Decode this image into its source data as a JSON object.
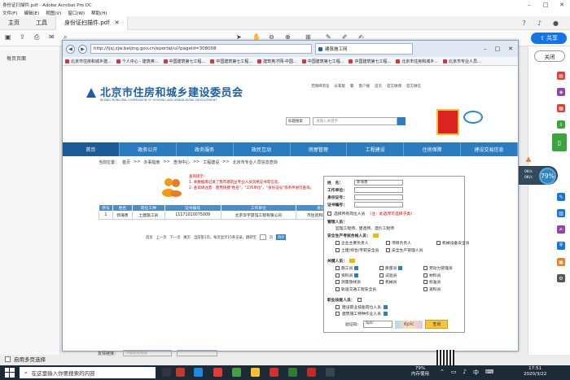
{
  "acrobat": {
    "window_title": "身份证扫描件.pdf - Adobe Acrobat Pro DC",
    "menu": [
      "文件(F)",
      "编辑(E)",
      "视图(V)",
      "窗口(W)",
      "帮助(H)"
    ],
    "tabs": {
      "home": "主页",
      "tools": "工具",
      "doc": "身份证扫描件.pdf"
    },
    "share": "共享",
    "left_panel_title": "每页页面",
    "multi_page_select": "启用多页选择",
    "close": "关闭"
  },
  "browser": {
    "url": "http://tjsj.zjw.beijing.gov.cn/eportal/ui?pageId=308008",
    "active_tab": "建筑施工网",
    "favorites": [
      "北京市住房和城乡建...",
      "个人中心 - 建筑英...",
      "中国建筑第七工程...",
      "中国建筑第七工程...",
      "建筑英才网-中国...",
      "中国建筑第七工程...",
      "中国建筑第七工程...",
      "北京市住房和城乡...",
      "北京市专业人员..."
    ]
  },
  "site": {
    "title": "北京市住房和城乡建设委员会",
    "subtitle": "BEIJING MUNICIPAL COMMISSION OF HOUSING AND URBAN-RURAL DEVELOPMENT",
    "top_links": [
      "无障碍浏览",
      "长辈版",
      "繁",
      "客户端",
      "首页",
      "官方微博",
      "官方微信"
    ],
    "search_select": "标题搜索",
    "search_placeholder": "请输入关键字",
    "nav": [
      "首页",
      "政务公开",
      "政务服务",
      "政民互动",
      "房屋管理",
      "工程建设",
      "住房保障",
      "建设交易信息"
    ],
    "breadcrumb": [
      "当前位置：",
      "首页",
      ">>",
      "办事指南",
      ">>",
      "查询中心",
      ">>",
      "工程建设",
      ">>",
      "北京市专业人员信息查询"
    ],
    "notice": {
      "title": "查询提示：",
      "line1": "1. 本数据库记录了我市建筑业专业人员资格证书等信息。",
      "line2": "2. 查询请注意：使用快捷\"姓名\"，\"工作单位\"，\"身份证号\"等条件进行查询。"
    },
    "table": {
      "headers": [
        "序号",
        "姓名",
        "岗位工种",
        "证书编号",
        "工作单位",
        "发证机关"
      ],
      "rows": [
        [
          "1",
          "郭海勇",
          "土建施工员",
          "11171010075009",
          "北京华宇晟馆工程有限公司",
          "市住房和城乡建设委"
        ]
      ]
    },
    "pager": {
      "first": "首页",
      "prev": "上一页",
      "next": "下一页",
      "last": "尾页",
      "info": "当前第1页，每页显示15条记录，跳转至",
      "unit": "页",
      "go": "跳转"
    },
    "friend_links": "友情链接：",
    "friend_select": "市级政府网站"
  },
  "popup": {
    "name_label": "姓　名：",
    "name_value": "郭海勇",
    "work_unit_label": "工作单位：",
    "id_label": "身份证号：",
    "cert_label": "证书编号：",
    "select_all": "选择所有岗位人员",
    "select_hint": "（注：此选项可选择子类）",
    "sec1_title": "管理人员：",
    "sec1_items": "监理工程师、建造师、造价工程师",
    "sec2_title": "安全生产考核合格人员：",
    "sec2_items": [
      "企业主要负责人",
      "项目负责人",
      "机械设备安全员",
      "土建/综合/专职安全员",
      "安全生产管理人员"
    ],
    "sec3_title": "关键人员：",
    "sec3_items": [
      "施工员",
      "质量员",
      "劳动力管理员",
      "资料员",
      "试验员",
      "材料员",
      "测量放线员",
      "机械员",
      "标准员",
      "轨道交通工程安全员",
      "资料员"
    ],
    "sec4_title": "职业技能人员：",
    "sec4_items": [
      "建设职业技能岗位人员",
      "建筑施工特种作业人员"
    ],
    "captcha_label": "验证码：",
    "captcha_value": "6plc",
    "captcha_img": "6plc",
    "query_btn": "查询"
  },
  "widget": {
    "up": "0K/s",
    "down": "0K/s",
    "pct": "79%"
  },
  "taskbar": {
    "search": "在这里输入你要搜索的内容",
    "mem_pct": "79%",
    "mem_label": "内存使用",
    "time": "17:51",
    "date": "2020/3/22"
  }
}
